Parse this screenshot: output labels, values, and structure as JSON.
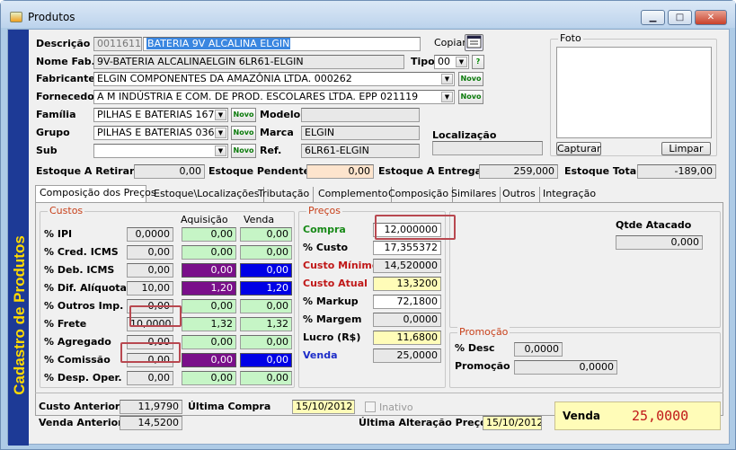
{
  "window": {
    "title": "Produtos",
    "min": "▁",
    "max": "□",
    "close": "✕"
  },
  "sidebar": {
    "title": "Cadastro de Produtos"
  },
  "header": {
    "descricao_label": "Descrição",
    "codigo": "0011611",
    "descricao": "BATERIA 9V ALCALINA ELGIN",
    "copiar_label": "Copiar",
    "nome_fab_label": "Nome Fab.",
    "nome_fab": "9V-BATERIA ALCALINAELGIN 6LR61-ELGIN",
    "tipo_label": "Tipo",
    "tipo": "00",
    "help": "?",
    "fabricante_label": "Fabricante",
    "fabricante": "ELGIN COMPONENTES DA AMAZÔNIA LTDA.   000262",
    "fornecedor_label": "Fornecedor",
    "fornecedor": "A M INDÚSTRIA E COM. DE PROD. ESCOLARES LTDA. EPP  021119",
    "familia_label": "Família",
    "familia": "PILHAS E BATERIAS   167",
    "grupo_label": "Grupo",
    "grupo": "PILHAS E BATERIAS   036",
    "sub_label": "Sub",
    "sub": "",
    "modelo_label": "Modelo",
    "modelo": "",
    "marca_label": "Marca",
    "marca": "ELGIN",
    "ref_label": "Ref.",
    "ref": "6LR61-ELGIN",
    "localizacao_label": "Localização",
    "localizacao": "",
    "novo": "Novo"
  },
  "foto": {
    "label": "Foto",
    "capturar": "Capturar",
    "limpar": "Limpar"
  },
  "estoque": {
    "a_retirar_label": "Estoque A Retirar",
    "a_retirar": "0,00",
    "pendente_label": "Estoque Pendente",
    "pendente": "0,00",
    "a_entregar_label": "Estoque A Entregar",
    "a_entregar": "259,000",
    "total_label": "Estoque Total",
    "total": "-189,00"
  },
  "tabs": [
    "Composição dos Preços",
    "Estoque\\Localizações",
    "Tributação",
    "Complemento",
    "Composição",
    "Similares",
    "Outros",
    "Integração"
  ],
  "custos": {
    "title": "Custos",
    "col_aquisicao": "Aquisição",
    "col_venda": "Venda",
    "rows": [
      {
        "label": "% IPI",
        "v": "0,0000",
        "a": "0,00",
        "s": "0,00"
      },
      {
        "label": "% Cred. ICMS",
        "v": "0,00",
        "a": "0,00",
        "s": "0,00"
      },
      {
        "label": "% Deb. ICMS",
        "v": "0,00",
        "a": "0,00",
        "s": "0,00"
      },
      {
        "label": "% Dif. Alíquota",
        "v": "10,00",
        "a": "1,20",
        "s": "1,20"
      },
      {
        "label": "% Outros Imp.",
        "v": "0,00",
        "a": "0,00",
        "s": "0,00"
      },
      {
        "label": "% Frete",
        "v": "10,0000",
        "a": "1,32",
        "s": "1,32"
      },
      {
        "label": "% Agregado",
        "v": "0,00",
        "a": "0,00",
        "s": "0,00"
      },
      {
        "label": "% Comissão",
        "v": "0,00",
        "a": "0,00",
        "s": "0,00"
      },
      {
        "label": "% Desp. Oper.",
        "v": "0,00",
        "a": "0,00",
        "s": "0,00"
      }
    ]
  },
  "precos": {
    "title": "Preços",
    "compra_label": "Compra",
    "compra": "12,000000",
    "custo_label": "% Custo",
    "custo": "17,355372",
    "custo_minimo_label": "Custo Mínimo",
    "custo_minimo": "14,520000",
    "custo_atual_label": "Custo Atual",
    "custo_atual": "13,3200",
    "markup_label": "% Markup",
    "markup": "72,1800",
    "margem_label": "% Margem",
    "margem": "0,0000",
    "lucro_label": "Lucro (R$)",
    "lucro": "11,6800",
    "venda_label": "Venda",
    "venda": "25,0000"
  },
  "atacado": {
    "label": "Qtde Atacado",
    "value": "0,000"
  },
  "promocao": {
    "title": "Promoção",
    "desc_label": "% Desc",
    "desc": "0,0000",
    "promocao_label": "Promoção",
    "promocao": "0,0000"
  },
  "footer": {
    "custo_anterior_label": "Custo  Anterior",
    "custo_anterior": "11,9790",
    "venda_anterior_label": "Venda Anterior",
    "venda_anterior": "14,5200",
    "ultima_compra_label": "Última Compra",
    "ultima_compra": "15/10/2012",
    "inativo_label": "Inativo",
    "ultima_alteracao_label": "Última Alteração Preço",
    "ultima_alteracao": "15/10/2012",
    "venda_label": "Venda",
    "venda": "25,0000"
  }
}
